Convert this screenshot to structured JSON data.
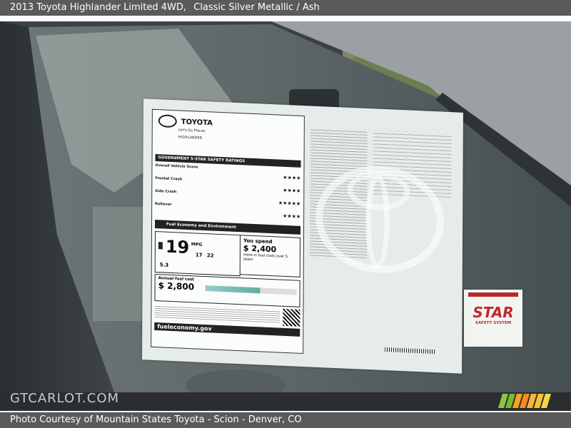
{
  "header": {
    "vehicle": "2013 Toyota Highlander Limited 4WD,",
    "color": "Classic Silver Metallic / Ash"
  },
  "footer": {
    "credit": "Photo Courtesy of Mountain States Toyota - Scion - Denver, CO"
  },
  "watermark": {
    "text": "GTCARLOT.COM"
  },
  "sticker": {
    "brand": "TOYOTA",
    "tagline": "Let's Go Places",
    "model": "HIGHLANDER",
    "safety_title": "GOVERNMENT 5-STAR SAFETY RATINGS",
    "overall": "Overall Vehicle Score",
    "frontal": "Frontal Crash",
    "side": "Side Crash",
    "rollover": "Rollover",
    "fuel_header": "Fuel Economy and Environment",
    "fuel_type": "Gasoline Vehicle",
    "mpg": "19",
    "mpg_label": "MPG",
    "city": "17",
    "hwy": "22",
    "gal_100mi": "5.3",
    "you_spend": "You spend",
    "spend_value": "$ 2,400",
    "spend_note": "more in fuel costs over 5 years",
    "annual_label": "Annual fuel cost",
    "annual_value": "$ 2,800",
    "site": "fueleconomy.gov",
    "star_brand": "STAR",
    "star_sub": "SAFETY SYSTEM"
  }
}
